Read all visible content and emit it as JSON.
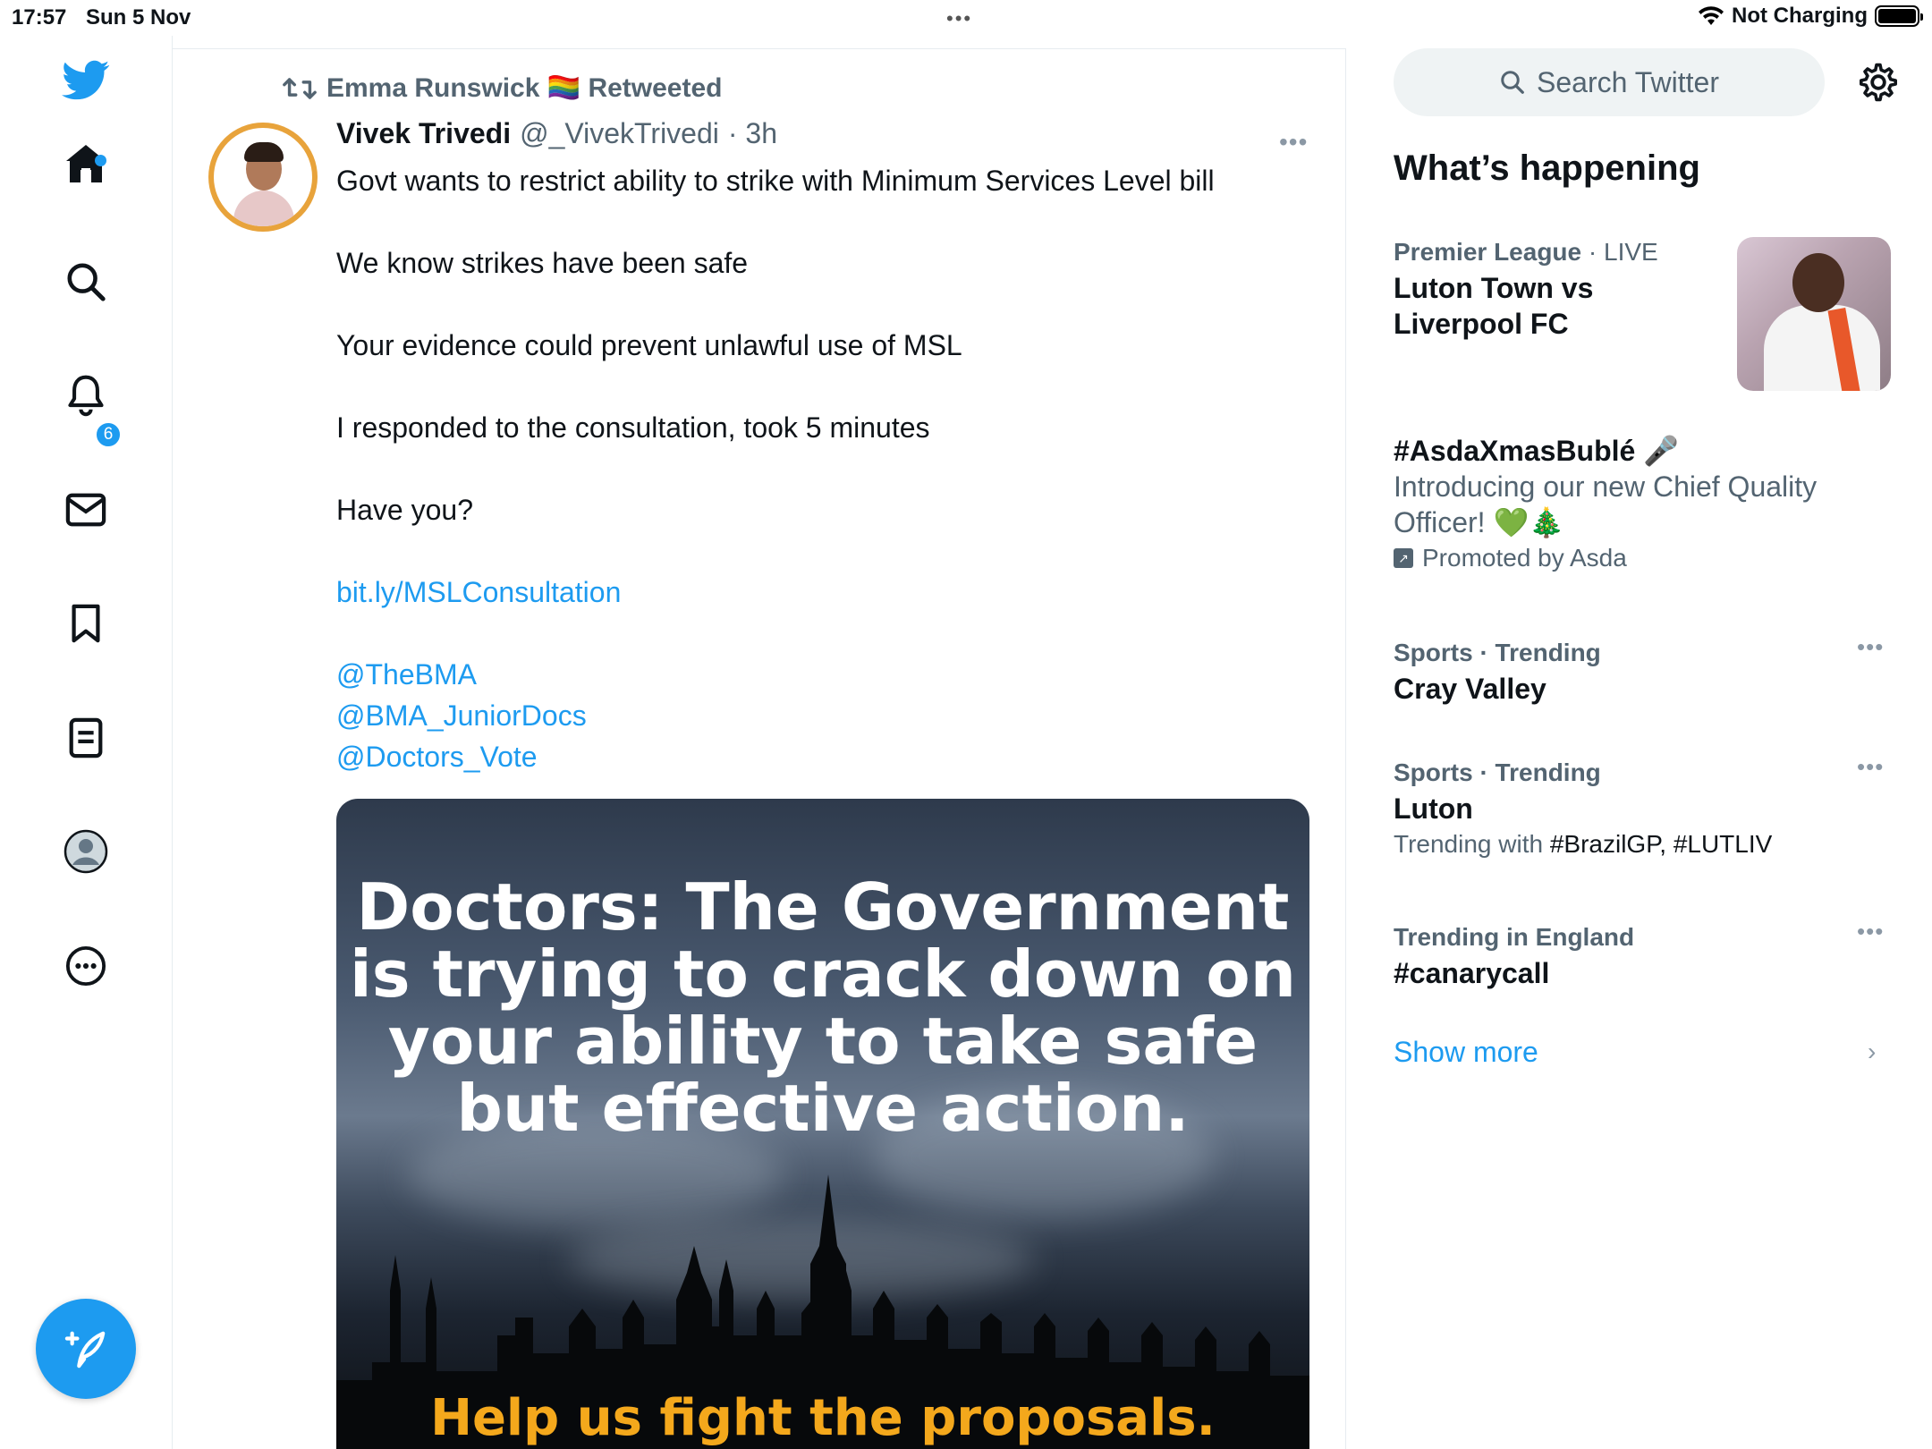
{
  "status_bar": {
    "time": "17:57",
    "date": "Sun 5 Nov",
    "center_dots": "•••",
    "charging": "Not Charging"
  },
  "nav": {
    "notifications_badge": "6",
    "icons": [
      "twitter-bird-icon",
      "home-icon",
      "search-icon",
      "bell-icon",
      "mail-icon",
      "bookmark-icon",
      "lists-icon",
      "profile-icon",
      "more-icon",
      "compose-icon"
    ]
  },
  "tweet": {
    "retweeted_by": "Emma Runswick 🏳️‍🌈 Retweeted",
    "author": "Vivek Trivedi",
    "handle": "@_VivekTrivedi",
    "time": "· 3h",
    "more": "•••",
    "lines": [
      "Govt wants to restrict ability to strike with Minimum Services Level bill",
      "We know strikes have been safe",
      "Your evidence could prevent unlawful use of MSL",
      "I responded to the consultation, took 5 minutes",
      "Have you?"
    ],
    "link": "bit.ly/MSLConsultation",
    "mentions": [
      "@TheBMA",
      "@BMA_JuniorDocs",
      "@Doctors_Vote"
    ],
    "media": {
      "headline": "Doctors: The Government is trying to crack down on your ability to take safe but effective action.",
      "headline_lines": [
        "Doctors: The Government",
        "is trying to crack down on",
        "your ability to take safe",
        "but effective action."
      ],
      "cta": "Help us fight the proposals."
    }
  },
  "sidebar": {
    "search_placeholder": "Search Twitter",
    "section_title": "What’s happening",
    "trends": [
      {
        "category": "Premier League",
        "suffix": "· LIVE",
        "title_lines": [
          "Luton Town vs",
          "Liverpool FC"
        ]
      },
      {
        "title": "#AsdaXmasBublé 🎤",
        "desc_lines": [
          "Introducing our new Chief Quality",
          "Officer! 💚🎄"
        ],
        "promo": "Promoted by Asda"
      },
      {
        "meta": "Sports · Trending",
        "title": "Cray Valley"
      },
      {
        "meta": "Sports · Trending",
        "title": "Luton",
        "extra_label": "Trending with",
        "extra_tags": "#BrazilGP, #LUTLIV"
      },
      {
        "meta": "Trending in England",
        "title": "#canarycall"
      }
    ],
    "trend_dots": "•••",
    "show_more": "Show more",
    "chevron": "›"
  },
  "colors": {
    "accent": "#1d9bf0",
    "text_secondary": "#536471",
    "media_cta": "#f4a81c"
  }
}
